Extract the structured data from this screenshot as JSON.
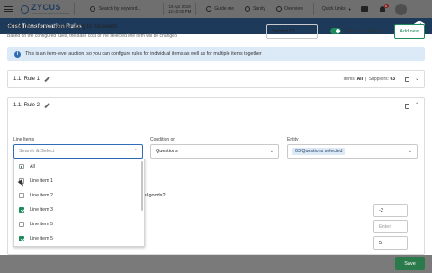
{
  "topbar": {
    "brand": "ZYCUS",
    "brand_tag": "COGNITIVE PROCUREMENT",
    "search_placeholder": "Search by keyword...",
    "date": "19 Apr 2019",
    "time": "12:40:00 PM",
    "guide": "Guide me",
    "sanity": "Sanity",
    "overview": "Overview",
    "quick_links": "Quick Links",
    "notification_count": "6"
  },
  "modal": {
    "title": "Cost Transformation Rules",
    "define_title": "Define the rule you want to apply to this event.",
    "define_sub": "Based on the configured rules, the base cost of the selected line item will be changed",
    "section_value": "Section 01",
    "visible_label": "Visible to Suppliers",
    "add_new": "Add new",
    "info_text": "This is an item-level auction, so you can configure rules for individual items as well as for multiple items together",
    "rule1": {
      "title": "1.1: Rule 1",
      "items_label": "Items:",
      "items_value": "All",
      "suppliers_label": "Suppliers:",
      "suppliers_value": "03"
    },
    "rule2": {
      "title": "1.1: Rule 2",
      "line_items_label": "Line Items",
      "line_items_placeholder": "Search & Select",
      "condition_label": "Condition on",
      "condition_value": "Questions",
      "entity_label": "Entity",
      "entity_value": "03 Questions selected",
      "question_text": "r critical goods?",
      "values": [
        "-2",
        "Enter",
        "5"
      ]
    },
    "dropdown": [
      {
        "label": "All",
        "state": "partial"
      },
      {
        "label": "Line item 1",
        "state": "unchecked"
      },
      {
        "label": "Line item 2",
        "state": "unchecked"
      },
      {
        "label": "Line item 3",
        "state": "checked"
      },
      {
        "label": "Line item 5",
        "state": "unchecked"
      },
      {
        "label": "Line item 5",
        "state": "checked"
      }
    ],
    "save": "Save"
  }
}
